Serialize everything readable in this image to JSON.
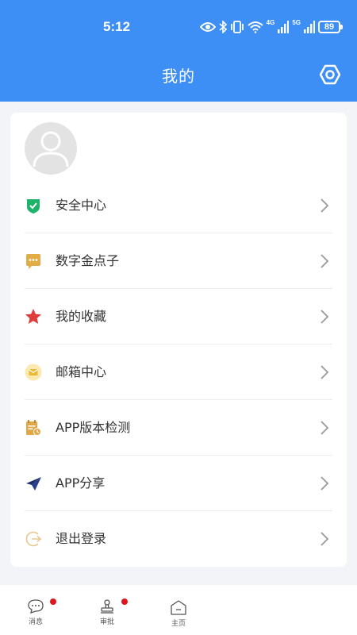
{
  "status_bar": {
    "time": "5:12",
    "battery": "89",
    "net1": "4G",
    "net2": "5G"
  },
  "header": {
    "title": "我的"
  },
  "menu": [
    {
      "label": "安全中心",
      "icon": "shield-check-icon"
    },
    {
      "label": "数字金点子",
      "icon": "chat-bubble-icon"
    },
    {
      "label": "我的收藏",
      "icon": "star-icon"
    },
    {
      "label": "邮箱中心",
      "icon": "mail-icon"
    },
    {
      "label": "APP版本检测",
      "icon": "calendar-clock-icon"
    },
    {
      "label": "APP分享",
      "icon": "paper-plane-icon"
    },
    {
      "label": "退出登录",
      "icon": "logout-icon"
    }
  ],
  "tabbar": [
    {
      "label": "消息",
      "icon": "message-icon"
    },
    {
      "label": "审批",
      "icon": "stamp-icon"
    },
    {
      "label": "主页",
      "icon": "home-icon"
    }
  ],
  "colors": {
    "header": "#3d8ef5",
    "badge": "#e0141e"
  }
}
